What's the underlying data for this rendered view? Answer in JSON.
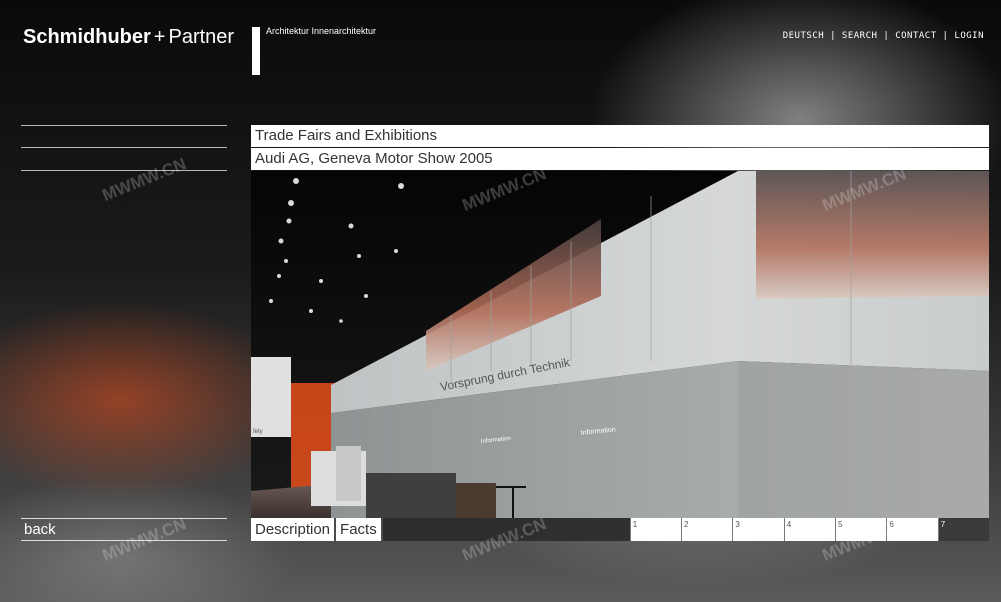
{
  "brand": {
    "name_bold": "Schmidhuber",
    "plus": "+",
    "name_light": "Partner"
  },
  "tagline": "Architektur  Innenarchitektur",
  "topnav": [
    "DEUTSCH",
    "SEARCH",
    "CONTACT",
    "LOGIN"
  ],
  "topnav_separator": " | ",
  "category_title": "Trade Fairs and Exhibitions",
  "project_title": "Audi AG, Geneva Motor Show 2005",
  "photo_texts": {
    "banner": "Vorsprung durch Technik",
    "info1": "Information",
    "info2": "Information",
    "sign": "fety"
  },
  "back_label": "back",
  "tabs": {
    "description": "Description",
    "facts": "Facts"
  },
  "pages": [
    "1",
    "2",
    "3",
    "4",
    "5",
    "6",
    "7"
  ],
  "active_page": "7",
  "watermark": "MWMW.CN",
  "colors": {
    "accent_orange": "#e8501c",
    "panel_white": "#ffffff",
    "dark_gray": "#3a3a3a"
  }
}
